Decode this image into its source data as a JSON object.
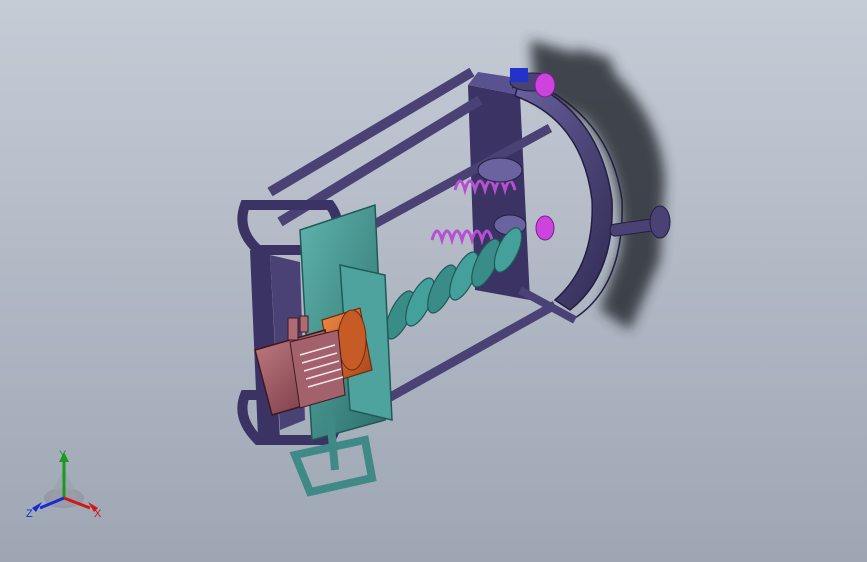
{
  "viewport": {
    "background_top": "#c6ccd6",
    "background_bottom": "#9ea6b4"
  },
  "model": {
    "frame_color": "#4a4275",
    "frame_dark": "#2f2a52",
    "plate_color": "#3f8a86",
    "spring_color": "#b64fd3",
    "auger_color": "#3a8c88",
    "motor_color": "#8d4b55",
    "gearbox_color": "#d9682e",
    "shadow_color": "#2a2d35"
  },
  "triad": {
    "x_label": "X",
    "y_label": "Y",
    "z_label": "Z",
    "x_color": "#d01818",
    "y_color": "#1a9a1a",
    "z_color": "#1a2bd0"
  }
}
